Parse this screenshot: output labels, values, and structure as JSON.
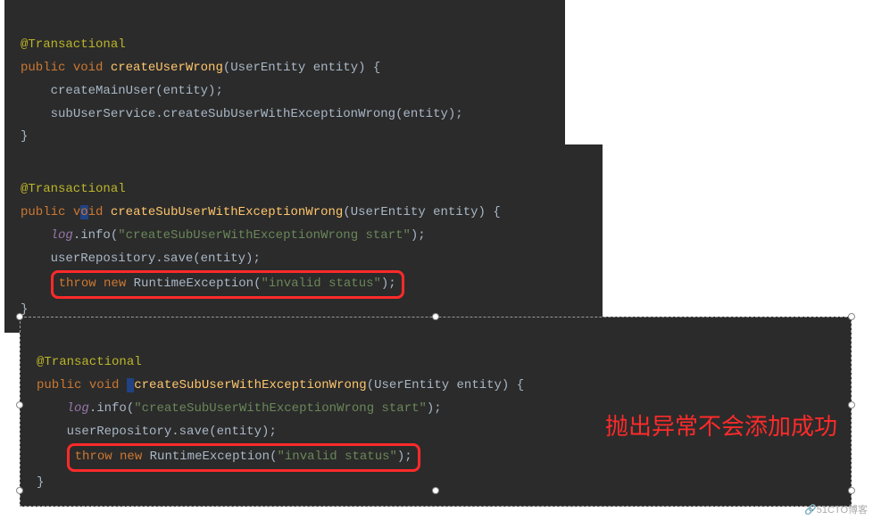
{
  "block1": {
    "anno": "@Transactional",
    "kw_public": "public",
    "kw_void": "void",
    "method": "createUserWrong",
    "sig_tail": "(UserEntity entity) {",
    "l1": "createMainUser(entity);",
    "l2a": "subUserService",
    "l2b": ".createSubUserWithExceptionWrong(entity);",
    "close": "}"
  },
  "block2": {
    "anno": "@Transactional",
    "kw_public": "public",
    "kw_void_pre": "v",
    "kw_void_mid": "o",
    "kw_void_post": "id",
    "method": "createSubUserWithExceptionWrong",
    "sig_tail": "(UserEntity entity) {",
    "log": "log",
    "info_call": ".info(",
    "str1": "\"createSubUserWithExceptionWrong start\"",
    "info_close": ");",
    "repo": "userRepository",
    "save": ".save(entity);",
    "throw": "throw",
    "new": "new",
    "rtex": "RuntimeException(",
    "str2": "\"invalid status\"",
    "rtex_close": ");",
    "close": "}"
  },
  "block3": {
    "anno": "@Transactional",
    "kw_public": "public",
    "kw_void": "void",
    "method": "createSubUserWithExceptionWrong",
    "sig_tail": "(UserEntity entity) {",
    "log": "log",
    "info_call": ".info(",
    "str1": "\"createSubUserWithExceptionWrong start\"",
    "info_close": ");",
    "repo": "userRepository",
    "save": ".save(entity);",
    "throw": "throw",
    "new": "new",
    "rtex": "RuntimeException(",
    "str2": "\"invalid status\"",
    "rtex_close": ");",
    "close": "}"
  },
  "comment": "抛出异常不会添加成功",
  "watermark": "🔗51CTO博客"
}
